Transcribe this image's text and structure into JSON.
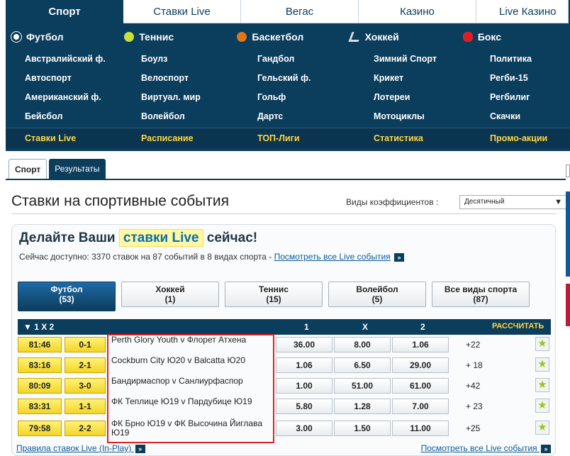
{
  "nav": {
    "tabs": [
      "Спорт",
      "Ставки Live",
      "Вегас",
      "Казино",
      "Live Казино"
    ],
    "sports": [
      {
        "label": "Футбол",
        "icon": "soccer-ball-icon",
        "color": "#ffffff"
      },
      {
        "label": "Теннис",
        "icon": "tennis-ball-icon",
        "color": "#c6e23a"
      },
      {
        "label": "Баскетбол",
        "icon": "basketball-icon",
        "color": "#e0761c"
      },
      {
        "label": "Хоккей",
        "icon": "hockey-stick-icon",
        "color": "#d7d7d7"
      },
      {
        "label": "Бокс",
        "icon": "boxing-glove-icon",
        "color": "#d8222a"
      }
    ],
    "sub": [
      [
        "Австралийский ф.",
        "Боулз",
        "Гандбол",
        "Зимний Спорт",
        "Политика"
      ],
      [
        "Автоспорт",
        "Велоспорт",
        "Гельский ф.",
        "Крикет",
        "Регби-15"
      ],
      [
        "Американский ф.",
        "Виртуал. мир",
        "Гольф",
        "Лотереи",
        "Регбилиг"
      ],
      [
        "Бейсбол",
        "Волейбол",
        "Дартс",
        "Мотоциклы",
        "Скачки"
      ]
    ],
    "bottom": [
      "Ставки Live",
      "Расписание",
      "ТОП-Лиги",
      "Статистика",
      "Промо-акции"
    ]
  },
  "subtabs": [
    "Спорт",
    "Результаты"
  ],
  "page": {
    "title": "Ставки на спортивные события",
    "odds_label": "Виды коэффициентов :",
    "odds_value": "Десятичный"
  },
  "live": {
    "head_pre": "Делайте Ваши",
    "head_hl": "ставки Live",
    "head_post": "сейчас!",
    "avail_text": "Сейчас доступно: 3370 ставок на 87 событий в 8 видах спорта -",
    "avail_link": "Посмотреть все Live события",
    "sport_buttons": [
      {
        "label": "Футбол",
        "count": "(53)"
      },
      {
        "label": "Хоккей",
        "count": "(1)"
      },
      {
        "label": "Теннис",
        "count": "(15)"
      },
      {
        "label": "Волейбол",
        "count": "(5)"
      },
      {
        "label": "Все виды спорта",
        "count": "(87)"
      }
    ],
    "table_header": {
      "market": "▼ 1 X 2",
      "c1": "1",
      "cx": "X",
      "c2": "2",
      "calc": "РАССЧИТАТЬ"
    },
    "events": [
      {
        "time": "81:46",
        "score": "0-1",
        "name": "Perth Glory Youth   v   Флорет Атхена",
        "o1": "36.00",
        "ox": "8.00",
        "o2": "1.06",
        "more": "+22"
      },
      {
        "time": "83:16",
        "score": "2-1",
        "name": "Cockburn City Ю20   v   Balcatta Ю20",
        "o1": "1.06",
        "ox": "6.50",
        "o2": "29.00",
        "more": "+ 18"
      },
      {
        "time": "80:09",
        "score": "3-0",
        "name": "Бандирмаспор   v   Санлиурфаспор",
        "o1": "1.00",
        "ox": "51.00",
        "o2": "61.00",
        "more": "+42"
      },
      {
        "time": "83:31",
        "score": "1-1",
        "name": "ФК Теплице Ю19   v   Пардубице Ю19",
        "o1": "5.80",
        "ox": "1.28",
        "o2": "7.00",
        "more": "+ 23"
      },
      {
        "time": "79:58",
        "score": "2-2",
        "name": "ФК Брно Ю19   v   ФК Высочина Йиглава Ю19",
        "o1": "3.00",
        "ox": "1.50",
        "o2": "11.00",
        "more": "+25"
      }
    ],
    "footer_left": "Правила ставок Live (In-Play)",
    "footer_right": "Посмотреть все Live события"
  }
}
